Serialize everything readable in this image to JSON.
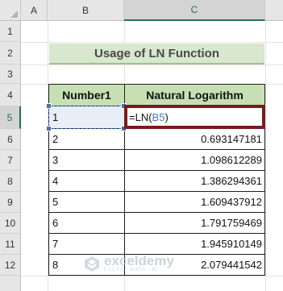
{
  "columns": [
    "A",
    "B",
    "C"
  ],
  "selected_column": "C",
  "rows": [
    "1",
    "2",
    "3",
    "4",
    "5",
    "6",
    "7",
    "8",
    "9",
    "10",
    "11",
    "12"
  ],
  "selected_row": "5",
  "title": "Usage of LN Function",
  "table": {
    "headers": [
      "Number1",
      "Natural Logarithm"
    ],
    "numbers": [
      "1",
      "2",
      "3",
      "4",
      "5",
      "6",
      "7",
      "8"
    ],
    "results": [
      "",
      "0.693147181",
      "1.098612289",
      "1.386294361",
      "1.609437912",
      "1.791759469",
      "1.945910149",
      "2.079441542"
    ]
  },
  "formula": {
    "prefix": "=LN(",
    "ref": "B5",
    "suffix": ")"
  },
  "colors": {
    "header_fill": "#c6e0b4",
    "title_fill": "#d8e7cd",
    "highlight_border": "#7a1a1e",
    "ref_color": "#4a78c8"
  },
  "watermark": {
    "name": "exceldemy",
    "tagline": "EXCEL · DATA · BI",
    "icon": "exceldemy-logo-icon"
  }
}
